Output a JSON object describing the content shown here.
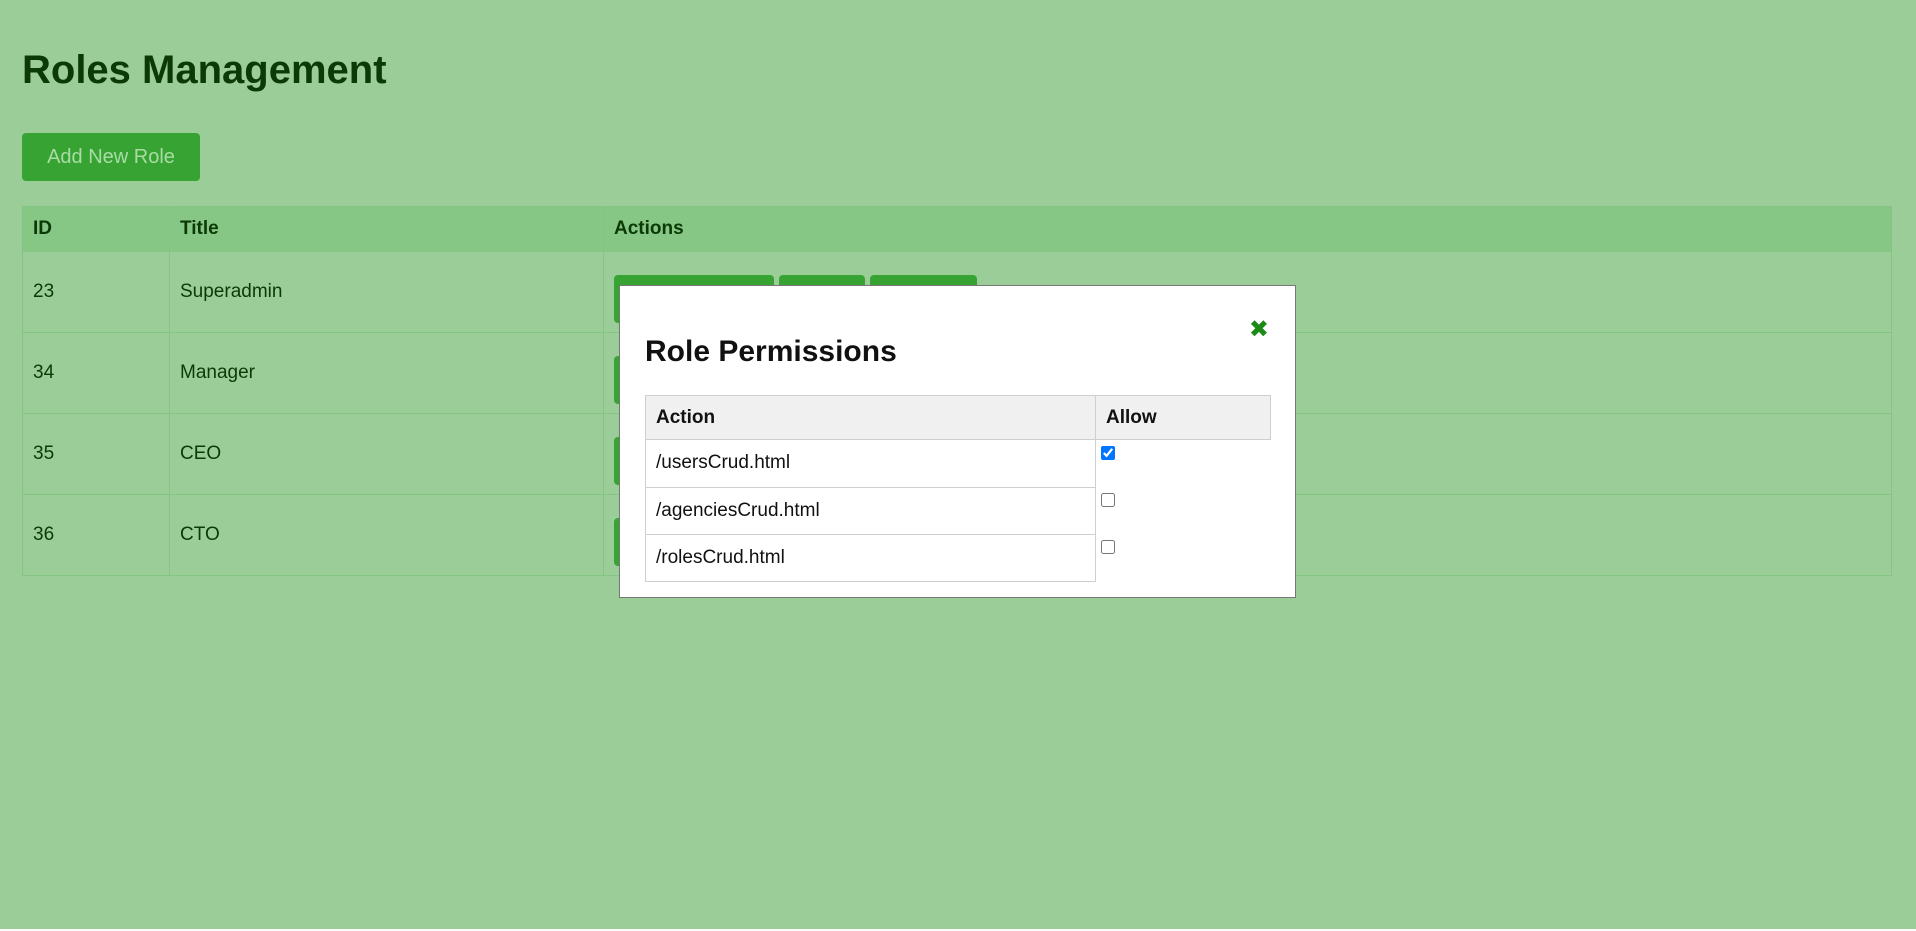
{
  "page": {
    "title": "Roles Management",
    "add_button_label": "Add New Role"
  },
  "roles_table": {
    "headers": [
      "ID",
      "Title",
      "Actions"
    ],
    "rows": [
      {
        "id": "23",
        "title": "Superadmin"
      },
      {
        "id": "34",
        "title": "Manager"
      },
      {
        "id": "35",
        "title": "CEO"
      },
      {
        "id": "36",
        "title": "CTO"
      }
    ]
  },
  "modal": {
    "title": "Role Permissions",
    "close_icon": "close-icon",
    "headers": [
      "Action",
      "Allow"
    ],
    "rows": [
      {
        "action": "/usersCrud.html",
        "allowed": true
      },
      {
        "action": "/agenciesCrud.html",
        "allowed": false
      },
      {
        "action": "/rolesCrud.html",
        "allowed": false
      }
    ]
  },
  "colors": {
    "page_background": "#9bcd99",
    "accent_green": "#36a333",
    "heading_text": "#0b3a07",
    "close_icon": "#1b8a17"
  }
}
